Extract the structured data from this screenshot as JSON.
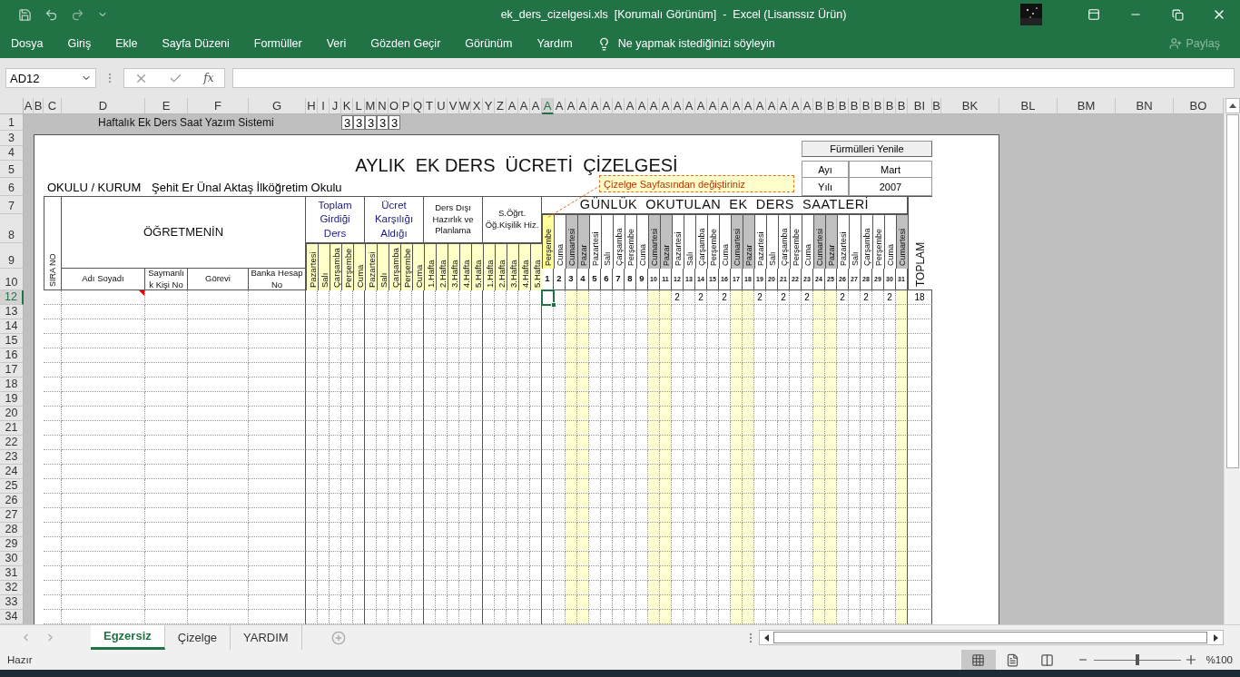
{
  "title_bar": {
    "title": "ek_ders_cizelgesi.xls  [Korumalı Görünüm]  -  Excel (Lisanssız Ürün)"
  },
  "menu": [
    {
      "label": "Dosya"
    },
    {
      "label": "Giriş"
    },
    {
      "label": "Ekle"
    },
    {
      "label": "Sayfa Düzeni"
    },
    {
      "label": "Formüller"
    },
    {
      "label": "Veri"
    },
    {
      "label": "Gözden Geçir"
    },
    {
      "label": "Görünüm"
    },
    {
      "label": "Yardım"
    }
  ],
  "tell_me": "Ne yapmak istediğinizi söyleyin",
  "share": "Paylaş",
  "formula_bar": {
    "name_box": "AD12",
    "function_label": "fx"
  },
  "columns": [
    {
      "label": "A",
      "selected": false
    },
    {
      "label": "B",
      "selected": false
    },
    {
      "label": "C",
      "selected": false
    },
    {
      "label": "D",
      "selected": false
    },
    {
      "label": "E",
      "selected": false
    },
    {
      "label": "F",
      "selected": false
    },
    {
      "label": "G",
      "selected": false
    },
    {
      "label": "H",
      "selected": false
    },
    {
      "label": "I",
      "selected": false
    },
    {
      "label": "J",
      "selected": false
    },
    {
      "label": "K",
      "selected": false
    },
    {
      "label": "L",
      "selected": false
    },
    {
      "label": "M",
      "selected": false
    },
    {
      "label": "N",
      "selected": false
    },
    {
      "label": "O",
      "selected": false
    },
    {
      "label": "P",
      "selected": false
    },
    {
      "label": "Q",
      "selected": false
    },
    {
      "label": "T",
      "selected": false
    },
    {
      "label": "U",
      "selected": false
    },
    {
      "label": "V",
      "selected": false
    },
    {
      "label": "W",
      "selected": false
    },
    {
      "label": "X",
      "selected": false
    },
    {
      "label": "Y",
      "selected": false
    },
    {
      "label": "Z",
      "selected": false
    },
    {
      "label": "A",
      "selected": false
    },
    {
      "label": "A",
      "selected": false
    },
    {
      "label": "A",
      "selected": false
    },
    {
      "label": "A",
      "selected": true
    },
    {
      "label": "A",
      "selected": false
    },
    {
      "label": "A",
      "selected": false
    },
    {
      "label": "A",
      "selected": false
    },
    {
      "label": "A",
      "selected": false
    },
    {
      "label": "A",
      "selected": false
    },
    {
      "label": "A",
      "selected": false
    },
    {
      "label": "A",
      "selected": false
    },
    {
      "label": "A",
      "selected": false
    },
    {
      "label": "A",
      "selected": false
    },
    {
      "label": "A",
      "selected": false
    },
    {
      "label": "A",
      "selected": false
    },
    {
      "label": "A",
      "selected": false
    },
    {
      "label": "A",
      "selected": false
    },
    {
      "label": "A",
      "selected": false
    },
    {
      "label": "A",
      "selected": false
    },
    {
      "label": "A",
      "selected": false
    },
    {
      "label": "A",
      "selected": false
    },
    {
      "label": "A",
      "selected": false
    },
    {
      "label": "A",
      "selected": false
    },
    {
      "label": "A",
      "selected": false
    },
    {
      "label": "A",
      "selected": false
    },
    {
      "label": "A",
      "selected": false
    },
    {
      "label": "B",
      "selected": false
    },
    {
      "label": "B",
      "selected": false
    },
    {
      "label": "B",
      "selected": false
    },
    {
      "label": "B",
      "selected": false
    },
    {
      "label": "B",
      "selected": false
    },
    {
      "label": "B",
      "selected": false
    },
    {
      "label": "B",
      "selected": false
    },
    {
      "label": "B",
      "selected": false
    },
    {
      "label": "BI",
      "selected": false
    },
    {
      "label": "B",
      "selected": false
    },
    {
      "label": "BK",
      "selected": false
    },
    {
      "label": "BL",
      "selected": false
    },
    {
      "label": "BM",
      "selected": false
    },
    {
      "label": "BN",
      "selected": false
    },
    {
      "label": "BO",
      "selected": false
    }
  ],
  "rows": [
    {
      "label": "1",
      "selected": false
    },
    {
      "label": "3",
      "selected": false
    },
    {
      "label": "4",
      "selected": false
    },
    {
      "label": "5",
      "selected": false
    },
    {
      "label": "6",
      "selected": false
    },
    {
      "label": "7",
      "selected": false
    },
    {
      "label": "8",
      "selected": false
    },
    {
      "label": "9",
      "selected": false
    },
    {
      "label": "10",
      "selected": false
    },
    {
      "label": "12",
      "selected": true
    },
    {
      "label": "13",
      "selected": false
    },
    {
      "label": "14",
      "selected": false
    },
    {
      "label": "15",
      "selected": false
    },
    {
      "label": "16",
      "selected": false
    },
    {
      "label": "17",
      "selected": false
    },
    {
      "label": "18",
      "selected": false
    },
    {
      "label": "19",
      "selected": false
    },
    {
      "label": "20",
      "selected": false
    },
    {
      "label": "21",
      "selected": false
    },
    {
      "label": "22",
      "selected": false
    },
    {
      "label": "23",
      "selected": false
    },
    {
      "label": "24",
      "selected": false
    },
    {
      "label": "25",
      "selected": false
    },
    {
      "label": "26",
      "selected": false
    },
    {
      "label": "27",
      "selected": false
    },
    {
      "label": "28",
      "selected": false
    },
    {
      "label": "29",
      "selected": false
    },
    {
      "label": "30",
      "selected": false
    },
    {
      "label": "31",
      "selected": false
    },
    {
      "label": "32",
      "selected": false
    },
    {
      "label": "33",
      "selected": false
    },
    {
      "label": "34",
      "selected": false
    }
  ],
  "sheet": {
    "banner": "Haftalık Ek Ders Saat Yazım Sistemi",
    "banner_cells": [
      "3",
      "3",
      "3",
      "3",
      "3"
    ],
    "heading": "AYLIK  EK DERS  ÜCRETİ  ÇİZELGESİ",
    "refresh_button": "Fürmülleri Yenile",
    "period": [
      {
        "label": "Ayı",
        "value": "Mart"
      },
      {
        "label": "Yılı",
        "value": "2007"
      }
    ],
    "school_label": "OKULU / KURUM",
    "school_name": "Şehit Er Ünal Aktaş İlköğretim Okulu",
    "comment": "Çizelge Sayfasından değiştiriniz",
    "serial_header": "SIRA NO",
    "teacher_header": "ÖĞRETMENİN",
    "teacher_columns": [
      "Adı Soyadı",
      "Saymanlık Kişi No",
      "Görevi",
      "Banka Hesap No"
    ],
    "groups": [
      {
        "title": "Toplam Girdiği Ders",
        "kind": "primary",
        "items": [
          "Pazartesi",
          "Salı",
          "Çarşamba",
          "Perşembe",
          "Cuma"
        ]
      },
      {
        "title": "Ücret Karşılığı Aldığı",
        "kind": "primary",
        "items": [
          "Pazartesi",
          "Salı",
          "Çarşamba",
          "Perşembe",
          "Cuma"
        ]
      },
      {
        "title": "Ders Dışı Hazırlık ve Planlama",
        "kind": "secondary",
        "items": [
          "1.Hafta",
          "2.Hafta",
          "3.Hafta",
          "4.Hafta",
          "5.Hafta"
        ]
      },
      {
        "title": "S.Öğrt. Öğ.Kişilik Hiz.",
        "kind": "secondary",
        "items": [
          "1.Hafta",
          "2.Hafta",
          "3.Hafta",
          "4.Hafta",
          "5.Hafta"
        ]
      }
    ],
    "daily_header": "GÜNLÜK  OKUTULAN  EK  DERS  SAATLERİ",
    "days": [
      {
        "name": "Perşembe",
        "number": "1",
        "kind": "noted"
      },
      {
        "name": "Cuma",
        "number": "2",
        "kind": "weekday"
      },
      {
        "name": "Cumartesi",
        "number": "3",
        "kind": "weekend"
      },
      {
        "name": "Pazar",
        "number": "4",
        "kind": "weekend"
      },
      {
        "name": "Pazartesi",
        "number": "5",
        "kind": "weekday"
      },
      {
        "name": "Salı",
        "number": "6",
        "kind": "weekday"
      },
      {
        "name": "Çarşamba",
        "number": "7",
        "kind": "weekday"
      },
      {
        "name": "Perşembe",
        "number": "8",
        "kind": "weekday"
      },
      {
        "name": "Cuma",
        "number": "9",
        "kind": "weekday"
      },
      {
        "name": "Cumartesi",
        "number": "10",
        "kind": "weekend"
      },
      {
        "name": "Pazar",
        "number": "11",
        "kind": "weekend"
      },
      {
        "name": "Pazartesi",
        "number": "12",
        "kind": "weekday",
        "hours": "2"
      },
      {
        "name": "Salı",
        "number": "13",
        "kind": "weekday"
      },
      {
        "name": "Çarşamba",
        "number": "14",
        "kind": "weekday",
        "hours": "2"
      },
      {
        "name": "Perşembe",
        "number": "15",
        "kind": "weekday"
      },
      {
        "name": "Cuma",
        "number": "16",
        "kind": "weekday",
        "hours": "2"
      },
      {
        "name": "Cumartesi",
        "number": "17",
        "kind": "weekend"
      },
      {
        "name": "Pazar",
        "number": "18",
        "kind": "weekend"
      },
      {
        "name": "Pazartesi",
        "number": "19",
        "kind": "weekday",
        "hours": "2"
      },
      {
        "name": "Salı",
        "number": "20",
        "kind": "weekday"
      },
      {
        "name": "Çarşamba",
        "number": "21",
        "kind": "weekday",
        "hours": "2"
      },
      {
        "name": "Perşembe",
        "number": "22",
        "kind": "weekday"
      },
      {
        "name": "Cuma",
        "number": "23",
        "kind": "weekday",
        "hours": "2"
      },
      {
        "name": "Cumartesi",
        "number": "24",
        "kind": "weekend"
      },
      {
        "name": "Pazar",
        "number": "25",
        "kind": "weekend"
      },
      {
        "name": "Pazartesi",
        "number": "26",
        "kind": "weekday",
        "hours": "2"
      },
      {
        "name": "Salı",
        "number": "27",
        "kind": "weekday"
      },
      {
        "name": "Çarşamba",
        "number": "28",
        "kind": "weekday",
        "hours": "2"
      },
      {
        "name": "Perşembe",
        "number": "29",
        "kind": "weekday"
      },
      {
        "name": "Cuma",
        "number": "30",
        "kind": "weekday",
        "hours": "2"
      },
      {
        "name": "Cumartesi",
        "number": "31",
        "kind": "weekend"
      }
    ],
    "total_header": "TOPLAM",
    "row_total": "18"
  },
  "sheet_tabs": [
    {
      "label": "Egzersiz",
      "selected": true
    },
    {
      "label": "Çizelge",
      "selected": false
    },
    {
      "label": "YARDIM",
      "selected": false
    }
  ],
  "status": "Hazır",
  "view_buttons": [
    {
      "kind": "normal",
      "selected": true
    },
    {
      "kind": "page_layout",
      "selected": false
    },
    {
      "kind": "page_break",
      "selected": false
    }
  ],
  "zoom": {
    "level": 0.5,
    "reading": "%100"
  }
}
